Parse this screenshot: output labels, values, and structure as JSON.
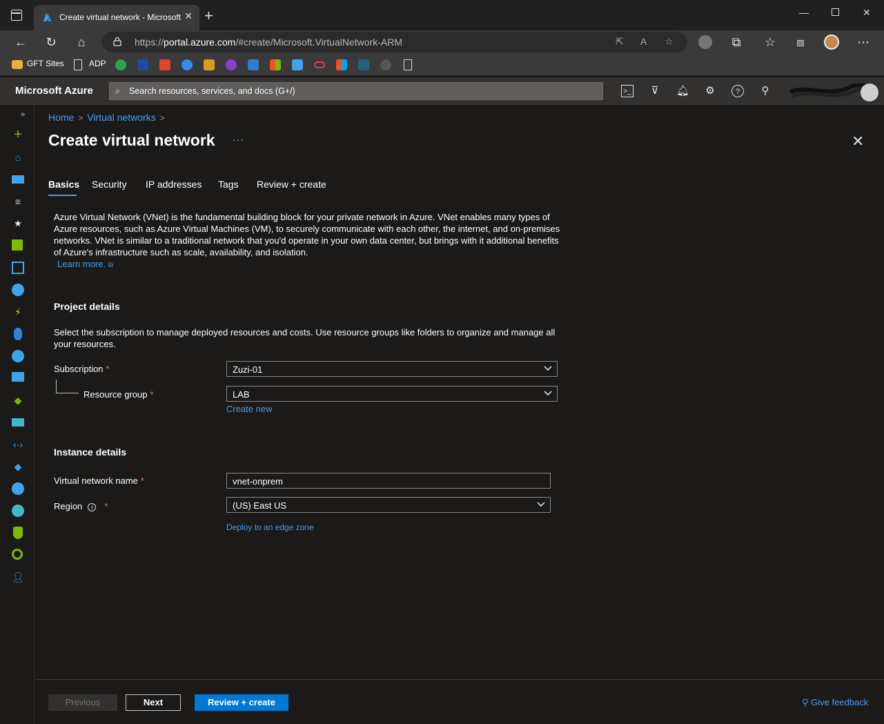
{
  "browser": {
    "tab_title": "Create virtual network - Microsoft Azure",
    "url_prefix": "https://",
    "url_host": "portal.azure.com",
    "url_path": "/#create/Microsoft.VirtualNetwork-ARM",
    "bookmarks": [
      "GFT Sites",
      "ADP"
    ]
  },
  "azure": {
    "brand": "Microsoft Azure",
    "search_placeholder": "Search resources, services, and docs (G+/)"
  },
  "breadcrumb": {
    "home": "Home",
    "virtual_networks": "Virtual networks"
  },
  "page": {
    "title": "Create virtual network",
    "more": "···",
    "tabs": [
      "Basics",
      "Security",
      "IP addresses",
      "Tags",
      "Review + create"
    ],
    "intro": "Azure Virtual Network (VNet) is the fundamental building block for your private network in Azure. VNet enables many types of Azure resources, such as Azure Virtual Machines (VM), to securely communicate with each other, the internet, and on-premises networks. VNet is similar to a traditional network that you'd operate in your own data center, but brings with it additional benefits of Azure's infrastructure such as scale, availability, and isolation.",
    "learn_more": "Learn more."
  },
  "project": {
    "heading": "Project details",
    "description": "Select the subscription to manage deployed resources and costs. Use resource groups like folders to organize and manage all your resources.",
    "subscription_label": "Subscription",
    "subscription_value": "Zuzi-01",
    "resource_group_label": "Resource group",
    "resource_group_value": "LAB",
    "create_new": "Create new"
  },
  "instance": {
    "heading": "Instance details",
    "vnet_name_label": "Virtual network name",
    "vnet_name_value": "vnet-onprem",
    "region_label": "Region",
    "region_value": "(US) East US",
    "edge_zone_link": "Deploy to an edge zone"
  },
  "required_marker": "*",
  "footer": {
    "previous": "Previous",
    "next": "Next",
    "review_create": "Review + create",
    "feedback": "Give feedback"
  },
  "colors": {
    "accent": "#0078d4",
    "link": "#4f9ce8",
    "background": "#1b1a19",
    "required": "#f1707b"
  },
  "icons": {
    "rail": [
      "expand-icon",
      "create-resource-icon",
      "home-icon",
      "dashboard-icon",
      "all-services-icon",
      "favorites-star-icon",
      "all-resources-icon",
      "resource-groups-icon",
      "app-services-icon",
      "function-app-icon",
      "sql-database-icon",
      "cosmos-db-icon",
      "virtual-machines-icon",
      "load-balancer-icon",
      "storage-account-icon",
      "virtual-network-icon",
      "entra-id-icon",
      "monitor-icon",
      "advisor-icon",
      "defender-icon",
      "cost-management-icon",
      "help-support-icon"
    ]
  }
}
